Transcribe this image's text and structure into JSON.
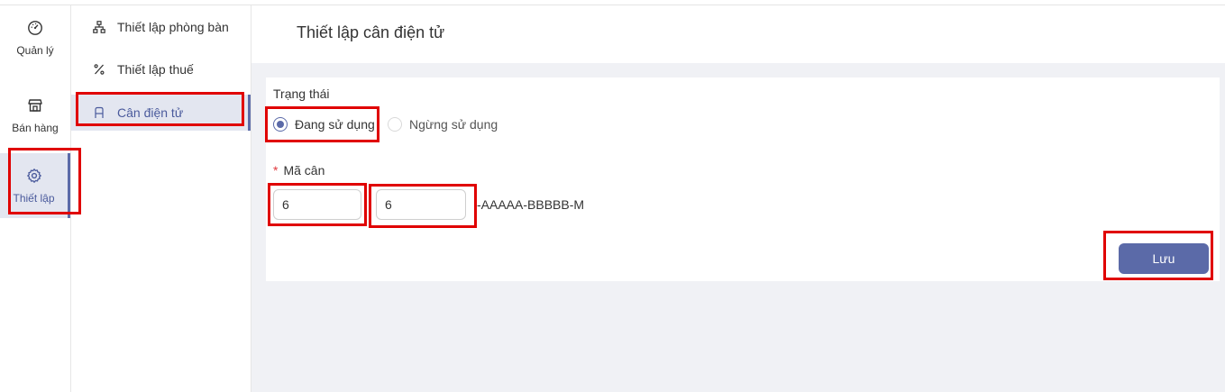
{
  "rail": {
    "items": [
      {
        "label": "Quản lý",
        "icon": "dashboard-icon"
      },
      {
        "label": "Bán hàng",
        "icon": "store-icon"
      },
      {
        "label": "Thiết lập",
        "icon": "gear-icon",
        "active": true
      }
    ]
  },
  "submenu": {
    "items": [
      {
        "label": "Thiết lập phòng bàn",
        "icon": "sitemap-icon"
      },
      {
        "label": "Thiết lập thuế",
        "icon": "percent-icon"
      },
      {
        "label": "Cân điện tử",
        "icon": "scale-icon",
        "active": true
      }
    ]
  },
  "main": {
    "title": "Thiết lập cân điện tử",
    "status": {
      "label": "Trạng thái",
      "options": [
        {
          "label": "Đang sử dụng",
          "checked": true
        },
        {
          "label": "Ngừng sử dụng",
          "checked": false
        }
      ]
    },
    "code": {
      "required_mark": "*",
      "label": "Mã cân",
      "field1_value": "6",
      "field2_value": "6",
      "suffix": "-AAAAA-BBBBB-M"
    },
    "save_label": "Lưu"
  },
  "colors": {
    "accent": "#5b6aa8",
    "active_bg": "#e3e6f0",
    "highlight": "#e00000",
    "required": "#e0393e"
  }
}
